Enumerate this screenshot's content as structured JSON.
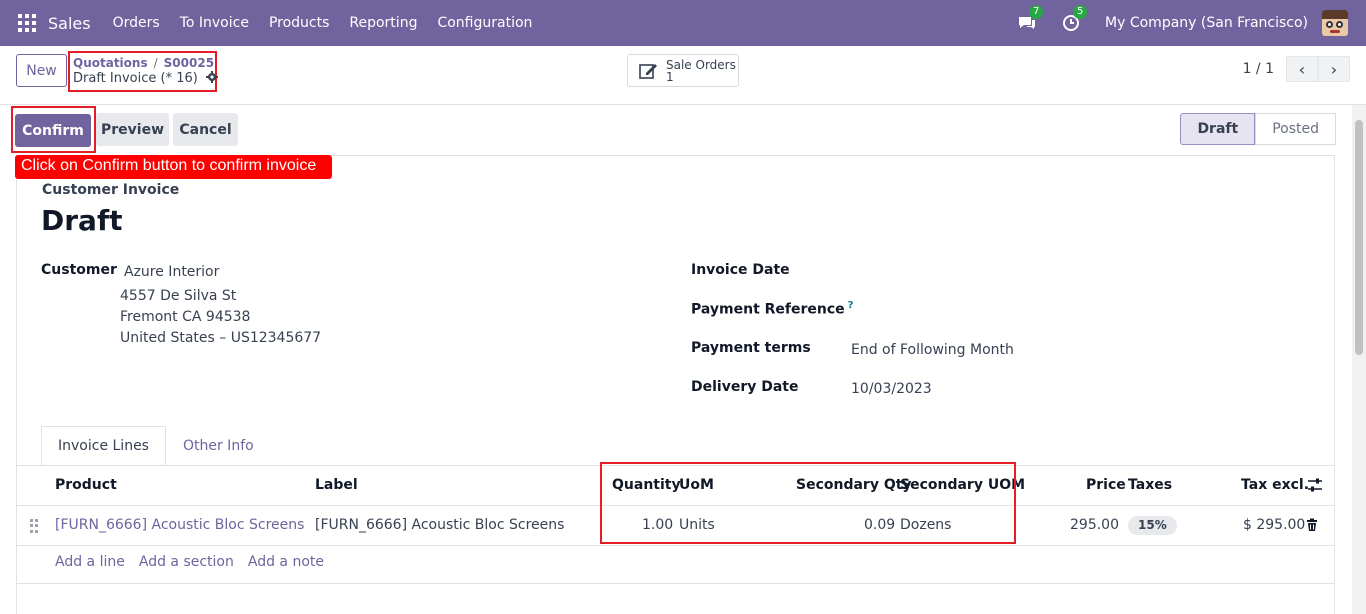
{
  "navbar": {
    "app_name": "Sales",
    "menu": [
      "Orders",
      "To Invoice",
      "Products",
      "Reporting",
      "Configuration"
    ],
    "messages_count": "7",
    "activities_count": "5",
    "company": "My Company (San Francisco)",
    "bg_color": "#71639e"
  },
  "control": {
    "new_label": "New",
    "breadcrumb_parent": "Quotations",
    "breadcrumb_sep": "/",
    "breadcrumb_child": "S00025",
    "record_name": "Draft Invoice (* 16)",
    "smart_button_label": "Sale Orders",
    "smart_button_count": "1",
    "pager_value": "1 / 1"
  },
  "statusbar": {
    "confirm_label": "Confirm",
    "preview_label": "Preview",
    "cancel_label": "Cancel",
    "stages": [
      "Draft",
      "Posted"
    ],
    "active_stage": "Draft"
  },
  "tooltip": "Click on Confirm button to confirm invoice",
  "invoice": {
    "doc_type": "Customer Invoice",
    "title": "Draft",
    "customer_label": "Customer",
    "customer_name": "Azure Interior",
    "address_line1": "4557 De Silva St",
    "address_line2": "Fremont CA 94538",
    "address_line3": "United States – US12345677",
    "invoice_date_label": "Invoice Date",
    "invoice_date": "",
    "payment_ref_label": "Payment Reference",
    "payment_ref_help": "?",
    "payment_terms_label": "Payment terms",
    "payment_terms": "End of Following Month",
    "delivery_date_label": "Delivery Date",
    "delivery_date": "10/03/2023"
  },
  "tabs": [
    "Invoice Lines",
    "Other Info"
  ],
  "lines": {
    "columns": {
      "product": "Product",
      "label": "Label",
      "quantity": "Quantity",
      "uom": "UoM",
      "secondary_qty": "Secondary Qty",
      "secondary_uom": "Secondary UOM",
      "price": "Price",
      "taxes": "Taxes",
      "tax_excl": "Tax excl."
    },
    "rows": [
      {
        "product": "[FURN_6666] Acoustic Bloc Screens",
        "label": "[FURN_6666] Acoustic Bloc Screens",
        "quantity": "1.00",
        "uom": "Units",
        "secondary_qty": "0.09",
        "secondary_uom": "Dozens",
        "price": "295.00",
        "taxes": "15%",
        "tax_excl": "$ 295.00"
      }
    ],
    "add_line": "Add a line",
    "add_section": "Add a section",
    "add_note": "Add a note"
  },
  "icons": {
    "apps": "apps-grid-icon",
    "messages": "chat-bubble-icon",
    "activities": "clock-icon",
    "gear": "gear-icon",
    "smart_button": "pencil-square-icon",
    "pager_prev": "chevron-left-icon",
    "pager_next": "chevron-right-icon",
    "column_settings": "sliders-icon",
    "delete": "trash-icon",
    "drag": "drag-handle-icon"
  },
  "colors": {
    "primary": "#71639e",
    "annotation_red": "#e41e26",
    "tooltip_red": "#ff0000",
    "badge_green": "#28a745"
  }
}
